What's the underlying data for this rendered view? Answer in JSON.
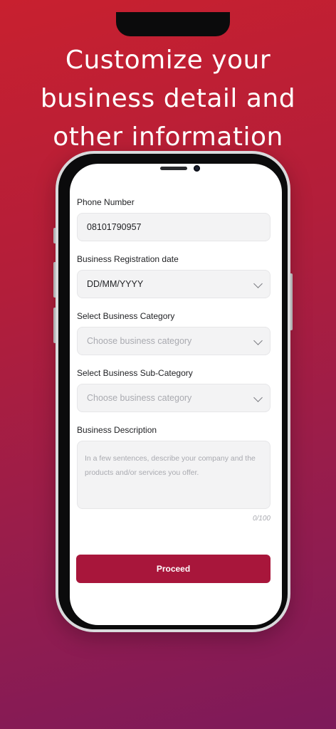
{
  "headline": {
    "line1": "Customize your",
    "line2": "business detail and",
    "line3": "other information"
  },
  "form": {
    "phone": {
      "label": "Phone Number",
      "value": "08101790957"
    },
    "registration_date": {
      "label": "Business Registration date",
      "value": "DD/MM/YYYY"
    },
    "category": {
      "label": "Select Business Category",
      "placeholder": "Choose business category"
    },
    "sub_category": {
      "label": "Select Business Sub-Category",
      "placeholder": "Choose business category"
    },
    "description": {
      "label": "Business Description",
      "placeholder": "In a few sentences, describe your company and the products and/or services you offer.",
      "counter": "0/100"
    },
    "proceed_label": "Proceed"
  },
  "colors": {
    "background_top": "#c8202f",
    "background_bottom": "#7d1a5a",
    "primary_button": "#a8163b"
  },
  "icons": {
    "dropdown": "chevron-down-icon"
  }
}
